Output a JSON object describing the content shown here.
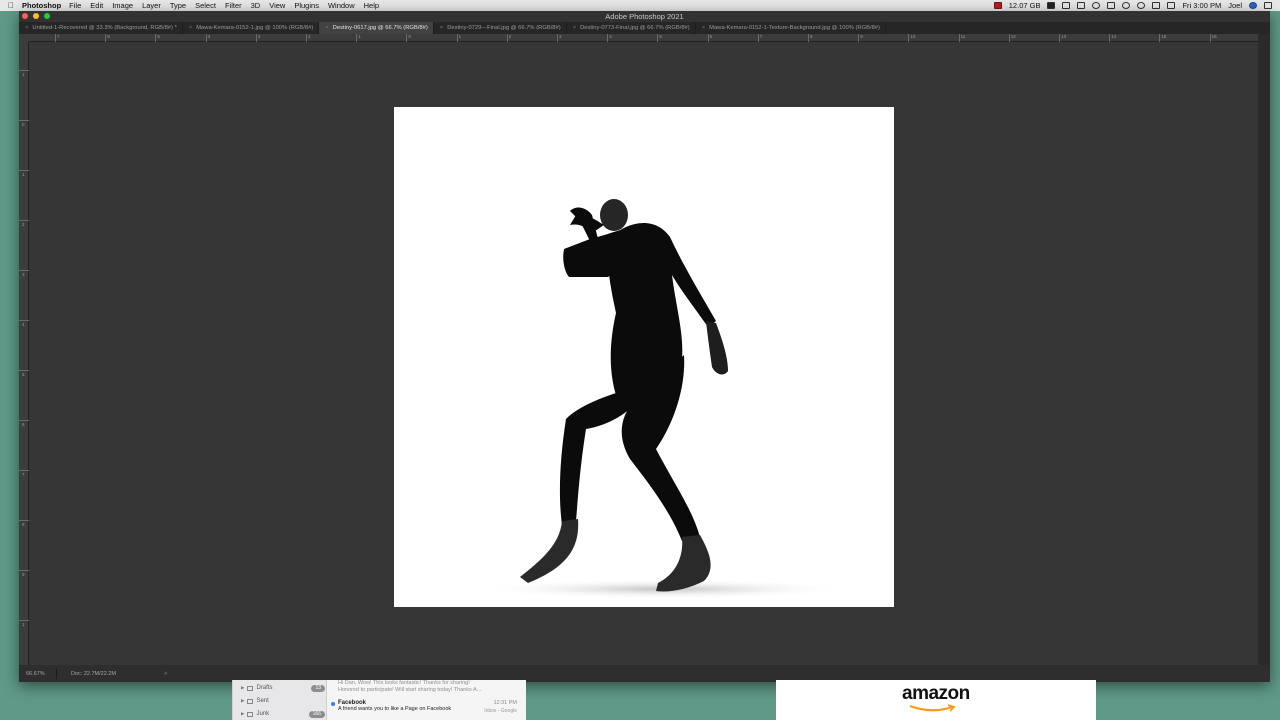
{
  "menubar": {
    "app_name": "Photoshop",
    "items": [
      "File",
      "Edit",
      "Image",
      "Layer",
      "Type",
      "Select",
      "Filter",
      "3D",
      "View",
      "Plugins",
      "Window",
      "Help"
    ],
    "memory": "12.07 GB",
    "clock": "Fri 3:00 PM",
    "user": "Joel"
  },
  "window": {
    "title": "Adobe Photoshop 2021"
  },
  "tabs": [
    {
      "label": "Untitled-1-Recovered @ 33.3% (Background, RGB/8#) *",
      "active": false
    },
    {
      "label": "Mawa-Kemara-0152-1.jpg @ 100% (RGB/8#)",
      "active": false
    },
    {
      "label": "Destiny-0617.jpg @ 66.7% (RGB/8#)",
      "active": true
    },
    {
      "label": "Destiny-0729---Final.jpg @ 66.7% (RGB/8#)",
      "active": false
    },
    {
      "label": "Destiny-0773-Final.jpg @ 66.7% (RGB/8#)",
      "active": false
    },
    {
      "label": "Mawa-Kemara-0152-1-Texture-Background.jpg @ 100% (RGB/8#)",
      "active": false
    }
  ],
  "ruler_h_labels": [
    "7",
    "8",
    "5",
    "4",
    "3",
    "2",
    "1",
    "0",
    "1",
    "2",
    "3",
    "4",
    "5",
    "6",
    "7",
    "8",
    "9",
    "10",
    "11",
    "12",
    "13",
    "14",
    "15",
    "16",
    "17"
  ],
  "ruler_v_labels": [
    "1",
    "0",
    "1",
    "2",
    "3",
    "4",
    "5",
    "6",
    "7",
    "8",
    "9",
    "1"
  ],
  "status": {
    "zoom": "66.67%",
    "doc": "Doc: 22.7M/22.2M",
    "arrow": ">"
  },
  "mail": {
    "folders": [
      {
        "name": "Drafts",
        "count": "13"
      },
      {
        "name": "Sent",
        "count": ""
      },
      {
        "name": "Junk",
        "count": "166"
      }
    ],
    "preview_line1": "Hi Dan, Wow! This looks fantastic! Thanks for sharing!",
    "preview_line2": "Honored to participate! Will start sharing today! Thanks A...",
    "message": {
      "from": "Facebook",
      "time": "12:31 PM",
      "subject": "A friend wants you to like a Page on Facebook",
      "mailbox": "Inbox - Google"
    }
  },
  "ad": {
    "brand": "amazon"
  },
  "colors": {
    "desktop": "#5f9a88",
    "workspace": "#363636",
    "canvas": "#ffffff"
  }
}
